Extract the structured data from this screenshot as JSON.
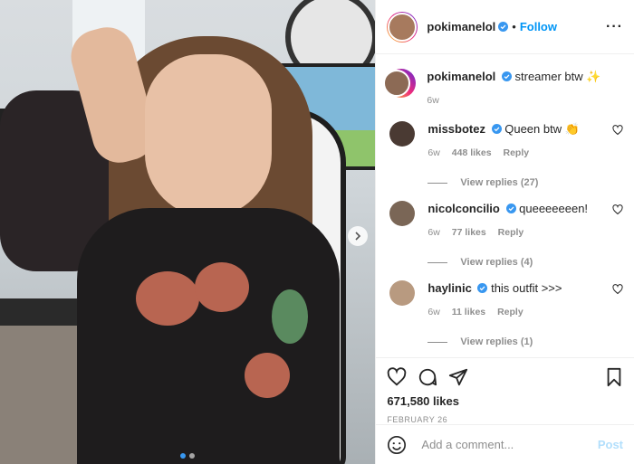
{
  "post": {
    "author": "pokimanelol",
    "follow_label": "Follow",
    "separator": "•",
    "more_label": "···"
  },
  "caption": {
    "username": "pokimanelol",
    "text": "streamer btw ✨",
    "time": "6w"
  },
  "comments": [
    {
      "username": "missbotez",
      "text": "Queen btw 👏",
      "time": "6w",
      "likes": "448 likes",
      "reply_label": "Reply",
      "view_replies": "View replies (27)"
    },
    {
      "username": "nicolconcilio",
      "text": "queeeeeeen!",
      "time": "6w",
      "likes": "77 likes",
      "reply_label": "Reply",
      "view_replies": "View replies (4)"
    },
    {
      "username": "haylinic",
      "text": "this outfit >>>",
      "time": "6w",
      "likes": "11 likes",
      "reply_label": "Reply",
      "view_replies": "View replies (1)"
    }
  ],
  "stats": {
    "likes": "671,580 likes",
    "date": "FEBRUARY 26"
  },
  "add_comment": {
    "placeholder": "Add a comment...",
    "post_label": "Post"
  },
  "carousel": {
    "current": 1,
    "total": 2
  },
  "colors": {
    "accent": "#0095f6",
    "verified": "#3897f0",
    "post_disabled": "#b2dffc",
    "muted": "#8e8e8e"
  },
  "icons": {
    "like": "heart-icon",
    "comment": "comment-icon",
    "share": "paper-plane-icon",
    "save": "bookmark-icon",
    "emoji": "emoji-icon",
    "verified": "verified-badge-icon",
    "next": "chevron-right-icon"
  }
}
